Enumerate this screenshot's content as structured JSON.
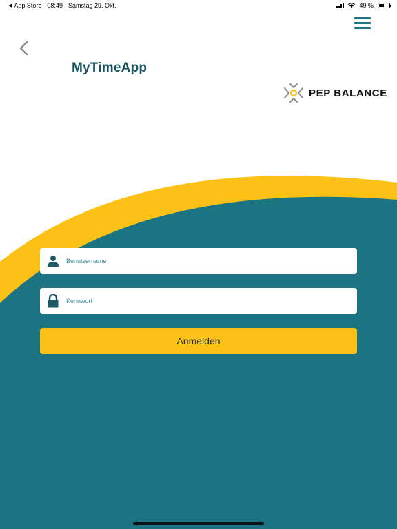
{
  "status_bar": {
    "back_app": "App Store",
    "time": "08:49",
    "date": "Samstag 29. Okt.",
    "battery_text": "49 %",
    "battery_level": 0.49
  },
  "header": {
    "app_title": "MyTimeApp",
    "brand_name": "PEP BALANCE"
  },
  "login_form": {
    "username_placeholder": "Benutzername",
    "password_placeholder": "Kennwort",
    "submit_label": "Anmelden"
  },
  "icons": {
    "menu": "hamburger-menu-icon",
    "back": "chevron-left-icon",
    "user": "user-icon",
    "lock": "lock-icon"
  },
  "colors": {
    "teal_background": "#1c7381",
    "accent_yellow": "#fcc117",
    "title_color": "#18535f"
  }
}
